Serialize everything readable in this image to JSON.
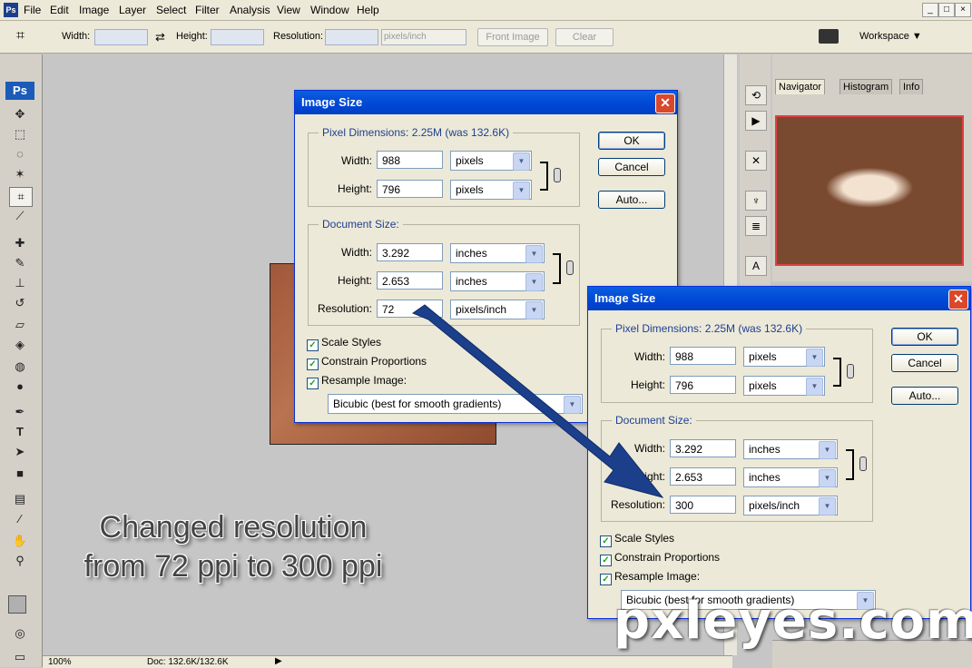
{
  "app": {
    "logo": "Ps",
    "menu": [
      "File",
      "Edit",
      "Image",
      "Layer",
      "Select",
      "Filter",
      "Analysis",
      "View",
      "Window",
      "Help"
    ],
    "window_buttons": [
      "_",
      "□",
      "×"
    ]
  },
  "options_bar": {
    "width_label": "Width:",
    "height_label": "Height:",
    "resolution_label": "Resolution:",
    "resolution_unit": "pixels/inch",
    "front_image": "Front Image",
    "clear": "Clear",
    "workspace": "Workspace ▼"
  },
  "status_bar": {
    "zoom": "100%",
    "doc": "Doc: 132.6K/132.6K"
  },
  "panels": {
    "tabs": [
      "Navigator",
      "Histogram",
      "Info"
    ]
  },
  "dialog_before": {
    "title": "Image Size",
    "pixel_dimensions_legend": "Pixel Dimensions:  2.25M (was 132.6K)",
    "width_label": "Width:",
    "width_px": "988",
    "height_label": "Height:",
    "height_px": "796",
    "px_unit": "pixels",
    "document_size_legend": "Document Size:",
    "doc_width": "3.292",
    "doc_height": "2.653",
    "doc_unit": "inches",
    "resolution_label": "Resolution:",
    "resolution": "72",
    "resolution_unit": "pixels/inch",
    "scale_styles": "Scale Styles",
    "constrain": "Constrain Proportions",
    "resample": "Resample Image:",
    "method": "Bicubic (best for smooth gradients)",
    "ok": "OK",
    "cancel": "Cancel",
    "auto": "Auto..."
  },
  "dialog_after": {
    "title": "Image Size",
    "pixel_dimensions_legend": "Pixel Dimensions:  2.25M (was 132.6K)",
    "width_label": "Width:",
    "width_px": "988",
    "height_label": "Height:",
    "height_px": "796",
    "px_unit": "pixels",
    "document_size_legend": "Document Size:",
    "doc_width": "3.292",
    "doc_height": "2.653",
    "doc_unit": "inches",
    "resolution_label": "Resolution:",
    "resolution": "300",
    "resolution_unit": "pixels/inch",
    "scale_styles": "Scale Styles",
    "constrain": "Constrain Proportions",
    "resample": "Resample Image:",
    "method": "Bicubic (best for smooth gradients)",
    "ok": "OK",
    "cancel": "Cancel",
    "auto": "Auto..."
  },
  "caption": "Changed resolution from 72 ppi to 300 ppi",
  "watermark": "pxleyes.com",
  "colors": {
    "title_bar": "#0046d5",
    "arrow": "#1c3f8c",
    "close": "#d9482b"
  }
}
